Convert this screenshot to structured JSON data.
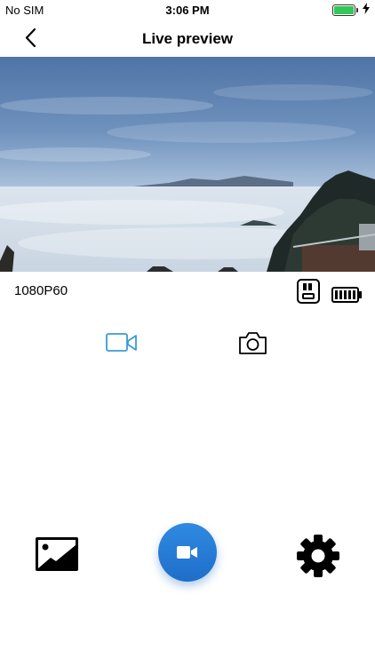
{
  "status_bar": {
    "carrier": "No SIM",
    "time": "3:06 PM",
    "battery_level": 1.0,
    "battery_color": "#34c759"
  },
  "nav": {
    "title": "Live preview",
    "back_icon": "chevron-left-icon"
  },
  "preview": {
    "description_icon": "live-camera-feed"
  },
  "info": {
    "resolution": "1080P60",
    "sd_icon": "sd-card-icon",
    "battery_icon": "camera-battery-icon",
    "camera_battery_level": 1.0
  },
  "modes": {
    "video_icon": "video-mode-icon",
    "photo_icon": "photo-mode-icon",
    "active": "video",
    "active_color": "#3a9ad9"
  },
  "bottom": {
    "gallery_icon": "gallery-icon",
    "record_icon": "record-video-icon",
    "settings_icon": "gear-icon",
    "accent": "#1f6ec9"
  }
}
